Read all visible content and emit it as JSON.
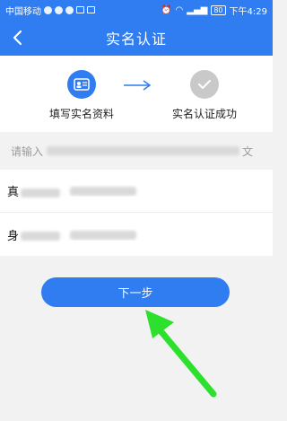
{
  "status_bar": {
    "carrier": "中国移动",
    "battery": "80",
    "time": "下午4:29"
  },
  "nav": {
    "title": "实名认证"
  },
  "steps": [
    {
      "label": "填写实名资料",
      "icon": "id-card-icon",
      "color": "#2f7df0"
    },
    {
      "label": "实名认证成功",
      "icon": "check-icon",
      "color": "#c9c9c9"
    }
  ],
  "notice": {
    "prefix": "请输入",
    "suffix": "文"
  },
  "form": {
    "name_label_prefix": "真",
    "name_placeholder": "请输入真实姓名",
    "id_label_prefix": "身",
    "id_placeholder": "请输入身份证号"
  },
  "actions": {
    "next_label": "下一步"
  },
  "colors": {
    "primary": "#2f7df0",
    "annotation_arrow": "#2ee02e"
  }
}
